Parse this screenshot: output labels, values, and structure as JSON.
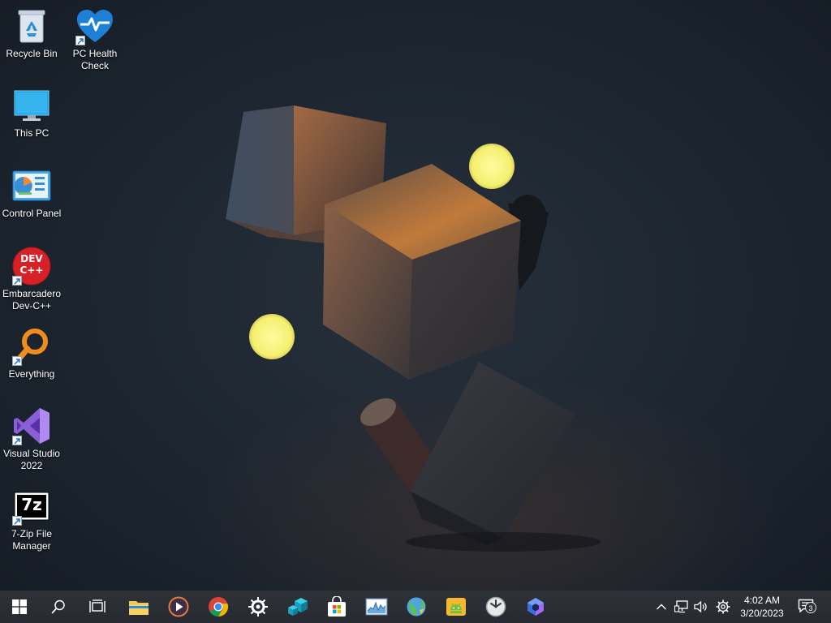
{
  "desktop": {
    "icons": [
      {
        "label": "Recycle Bin"
      },
      {
        "label": "PC Health Check"
      },
      {
        "label": "This PC"
      },
      {
        "label": "Control Panel"
      },
      {
        "label": "Embarcadero Dev-C++",
        "badge_text": "DEV C++"
      },
      {
        "label": "Everything"
      },
      {
        "label": "Visual Studio 2022"
      },
      {
        "label": "7-Zip File Manager",
        "badge_text": "7z"
      }
    ]
  },
  "taskbar": {
    "start_icon": "windows-logo-icon",
    "search_icon": "search-icon",
    "task_view_icon": "task-view-icon",
    "pinned_apps": [
      {
        "icon": "file-explorer-icon"
      },
      {
        "icon": "media-player-icon"
      },
      {
        "icon": "chrome-icon"
      },
      {
        "icon": "steelseries-icon"
      },
      {
        "icon": "isometric-app-icon"
      },
      {
        "icon": "microsoft-store-icon"
      },
      {
        "icon": "resource-monitor-icon"
      },
      {
        "icon": "globe-app-icon"
      },
      {
        "icon": "android-app-icon"
      },
      {
        "icon": "clock-app-icon"
      },
      {
        "icon": "copilot-icon"
      }
    ],
    "tray": {
      "chevron_icon": "chevron-up-icon",
      "network_icon": "network-icon",
      "volume_icon": "volume-icon",
      "settings_icon": "gear-icon"
    },
    "clock": {
      "time": "4:02 AM",
      "date": "3/20/2023"
    },
    "notifications": {
      "icon": "action-center-icon",
      "count": "3"
    }
  },
  "colors": {
    "taskbar_bg": "#2b2f36",
    "desktop_bg": "#1d2630",
    "accent_blue": "#0a78d7"
  }
}
